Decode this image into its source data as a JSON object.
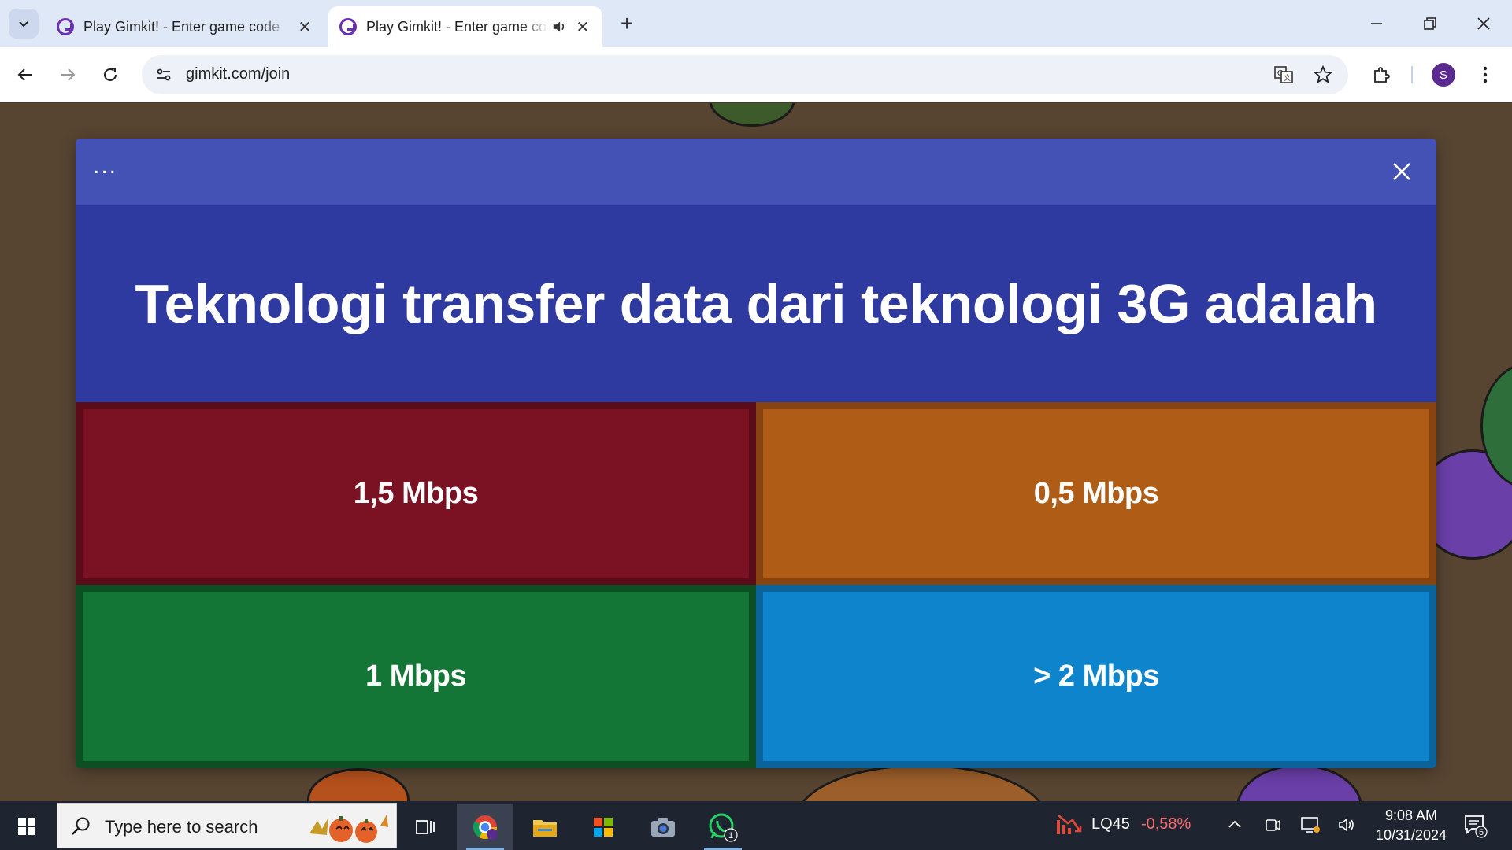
{
  "browser": {
    "tabs": [
      {
        "title": "Play Gimkit! - Enter game code",
        "active": false
      },
      {
        "title": "Play Gimkit! - Enter game code",
        "active": true,
        "audio": true
      }
    ],
    "new_tab_label": "+",
    "url": "gimkit.com/join",
    "profile_initial": "S"
  },
  "modal": {
    "more_label": "...",
    "question": "Teknologi transfer data dari teknologi 3G adalah",
    "answers": [
      {
        "label": "1,5 Mbps",
        "color": "#7b1224",
        "border": "#5a0c1a"
      },
      {
        "label": "0,5 Mbps",
        "color": "#ae5c16",
        "border": "#874410"
      },
      {
        "label": "1 Mbps",
        "color": "#137536",
        "border": "#0b4f23"
      },
      {
        "label": "> 2 Mbps",
        "color": "#0d84cc",
        "border": "#0a639b"
      }
    ]
  },
  "taskbar": {
    "search_placeholder": "Type here to search",
    "whatsapp_badge": "1",
    "stock_name": "LQ45",
    "stock_change": "-0,58%",
    "time": "9:08 AM",
    "date": "10/31/2024",
    "notification_count": "5"
  }
}
